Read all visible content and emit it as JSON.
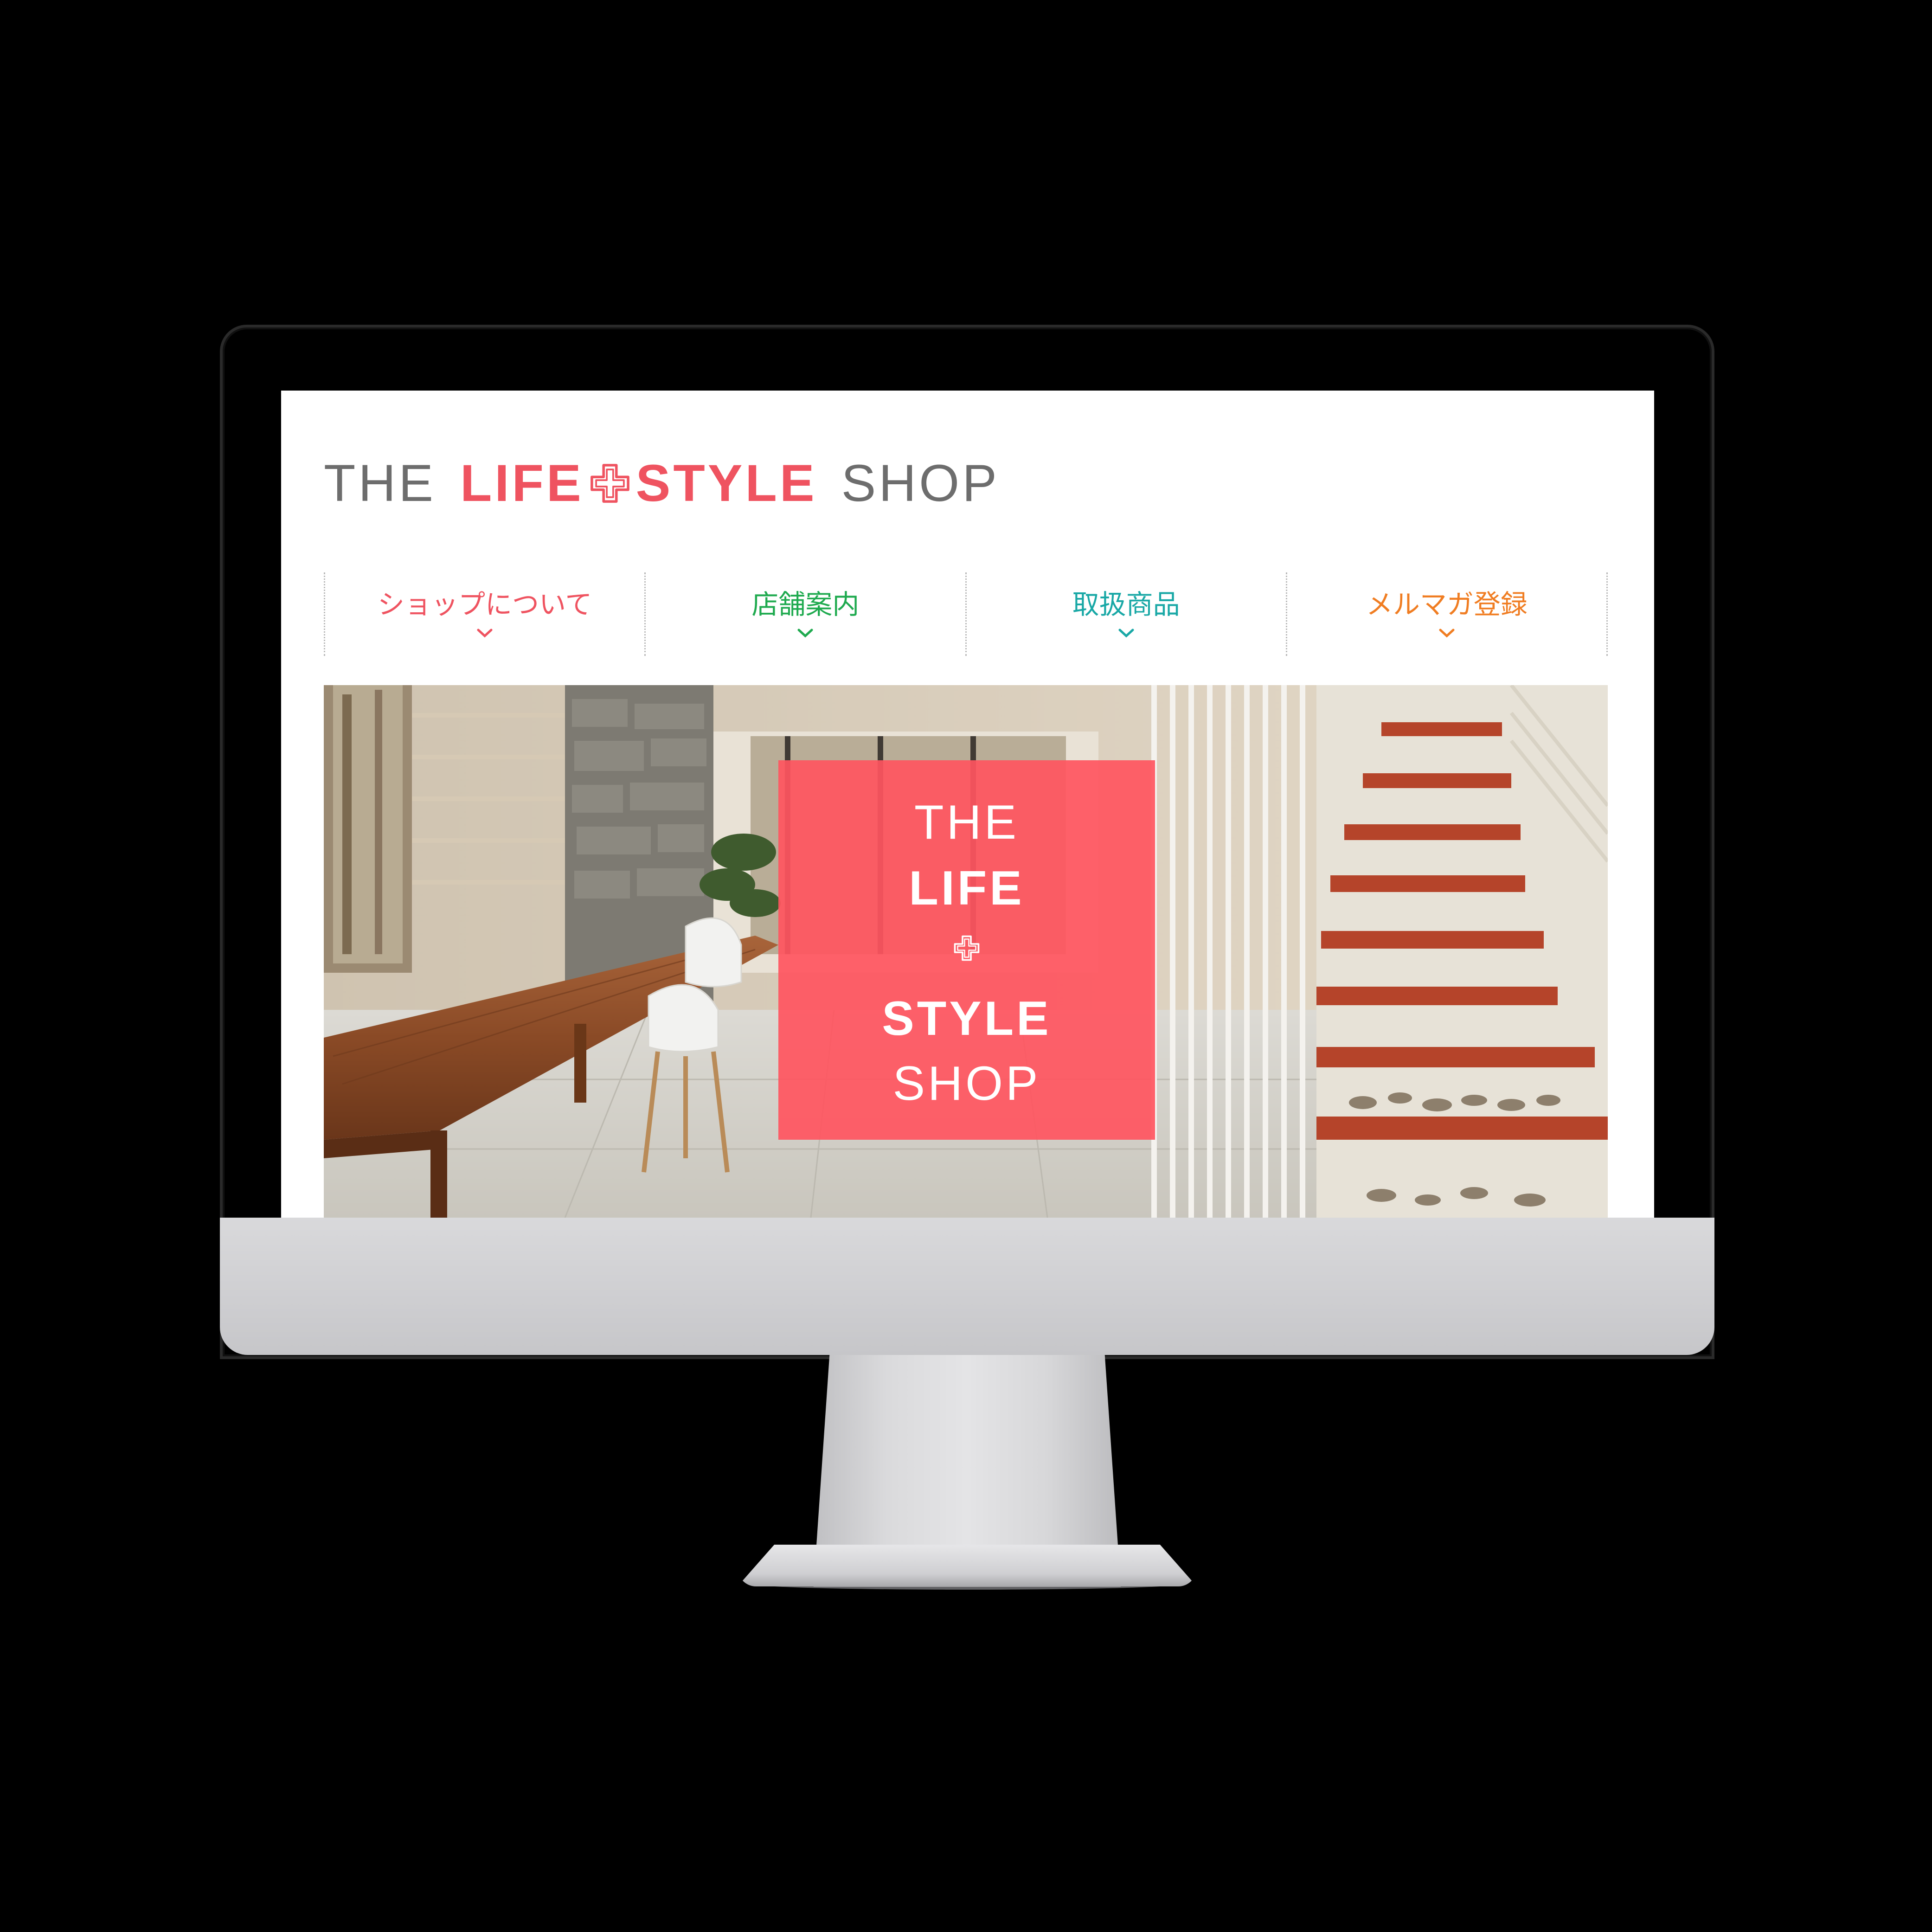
{
  "site": {
    "logo": {
      "word_the": "THE",
      "word_life": "LIFE",
      "word_style": "STYLE",
      "word_shop": "SHOP",
      "plus_icon": "plus-outline-icon"
    },
    "nav": [
      {
        "label": "ショップについて",
        "color": "#ef5360",
        "icon": "chevron-down-icon"
      },
      {
        "label": "店舗案内",
        "color": "#1faa4f",
        "icon": "chevron-down-icon"
      },
      {
        "label": "取扱商品",
        "color": "#19a8a6",
        "icon": "chevron-down-icon"
      },
      {
        "label": "メルマガ登録",
        "color": "#f07d22",
        "icon": "chevron-down-icon"
      }
    ],
    "hero": {
      "badge": {
        "line1": "THE",
        "line2": "LIFE",
        "line3": "STYLE",
        "line4": "SHOP",
        "plus_icon": "plus-outline-icon"
      }
    }
  },
  "colors": {
    "accent": "#ef5360",
    "logo_gray": "#6d6d6d",
    "divider": "#b9b9b9",
    "device_frame": "#000000",
    "device_chin": "#d2d2d4"
  }
}
